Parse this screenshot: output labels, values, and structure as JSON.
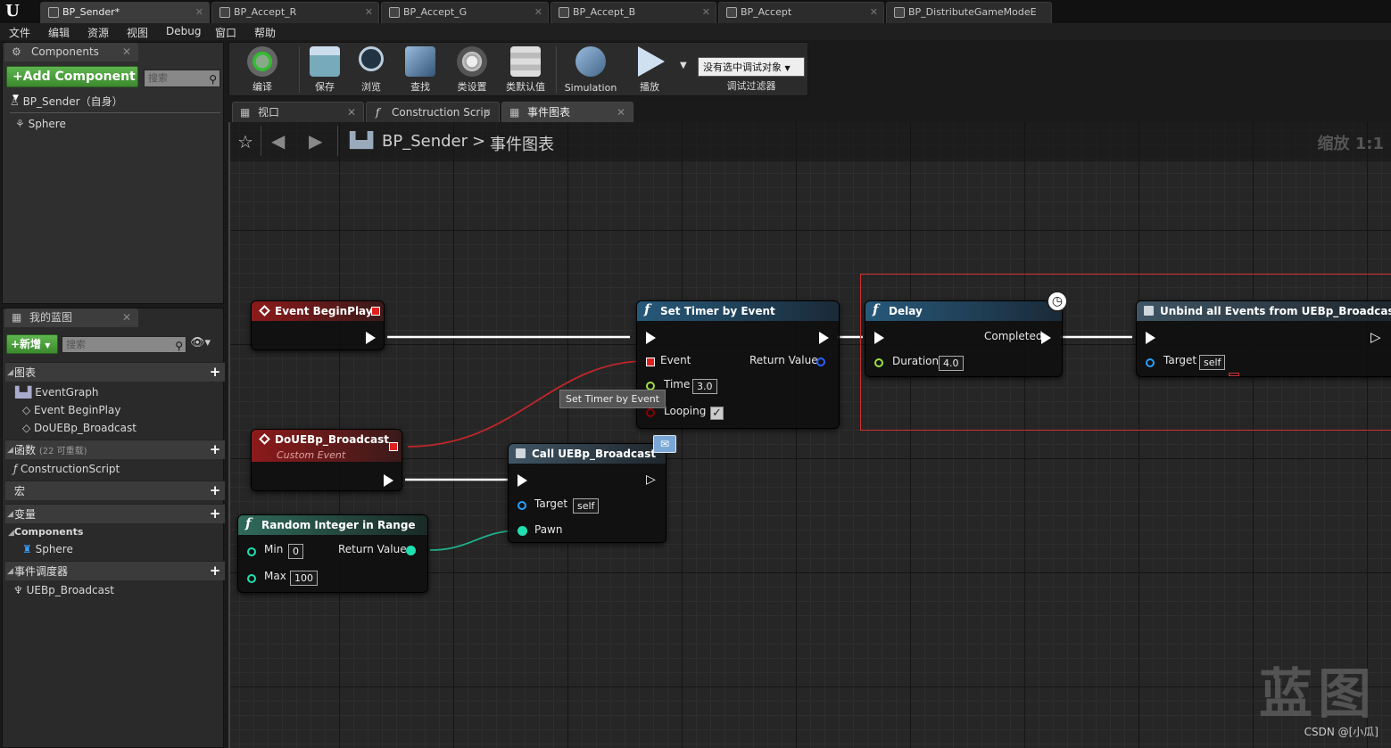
{
  "tabs": [
    {
      "label": "BP_Sender*",
      "active": true
    },
    {
      "label": "BP_Accept_R"
    },
    {
      "label": "BP_Accept_G"
    },
    {
      "label": "BP_Accept_B"
    },
    {
      "label": "BP_Accept"
    },
    {
      "label": "BP_DistributeGameModeE"
    }
  ],
  "menu": [
    "文件",
    "编辑",
    "资源",
    "视图",
    "Debug",
    "窗口",
    "帮助"
  ],
  "components_panel": {
    "tab": "Components",
    "add_button": "+Add Component",
    "search_placeholder": "搜索",
    "root_item": "BP_Sender（自身）",
    "child_item": "Sphere"
  },
  "my_blueprint": {
    "tab": "我的蓝图",
    "new_button": "+新增",
    "search_placeholder": "搜索",
    "sections": {
      "graphs": "图表",
      "functions": "函数",
      "functions_sub": "(22 可重载)",
      "macros": "宏",
      "variables": "变量",
      "dispatchers": "事件调度器"
    },
    "graph_items": [
      "EventGraph",
      "Event BeginPlay",
      "DoUEBp_Broadcast"
    ],
    "function_items": [
      "ConstructionScript"
    ],
    "var_category": "Components",
    "var_items": [
      "Sphere"
    ],
    "dispatcher_items": [
      "UEBp_Broadcast"
    ]
  },
  "toolbar": {
    "buttons": [
      "编译",
      "保存",
      "浏览",
      "查找",
      "类设置",
      "类默认值",
      "Simulation",
      "播放"
    ],
    "debug_select": "没有选中调试对象",
    "debug_label": "调试过滤器"
  },
  "graph_tabs": [
    "视口",
    "Construction Scrip",
    "事件图表"
  ],
  "graph": {
    "breadcrumb_bp": "BP_Sender",
    "breadcrumb_sep": ">",
    "breadcrumb_graph": "事件图表",
    "zoom": "缩放 1:1",
    "tooltip": "Set Timer by Event",
    "watermark": "蓝图",
    "credit": "CSDN @[小瓜]"
  },
  "nodes": {
    "begin_play": {
      "title": "Event BeginPlay"
    },
    "do_broadcast": {
      "title": "DoUEBp_Broadcast",
      "subtitle": "Custom Event"
    },
    "random": {
      "title": "Random Integer in Range",
      "min_label": "Min",
      "min_value": "0",
      "max_label": "Max",
      "max_value": "100",
      "return_label": "Return Value"
    },
    "call": {
      "title": "Call UEBp_Broadcast",
      "target_label": "Target",
      "target_value": "self",
      "pawn_label": "Pawn"
    },
    "set_timer": {
      "title": "Set Timer by Event",
      "event_label": "Event",
      "return_label": "Return Value",
      "time_label": "Time",
      "time_value": "3.0",
      "looping_label": "Looping",
      "looping_checked": true
    },
    "delay": {
      "title": "Delay",
      "completed_label": "Completed",
      "duration_label": "Duration",
      "duration_value": "4.0"
    },
    "unbind": {
      "title": "Unbind all Events from UEBp_Broadcast",
      "target_label": "Target",
      "target_value": "self"
    }
  },
  "colors": {
    "exec": "#ffffff",
    "delegate": "#e02020",
    "int": "#1fe0b0",
    "object": "#2aa0ff",
    "float": "#a0e040",
    "bool": "#8b0000",
    "selection": "#d03030"
  }
}
